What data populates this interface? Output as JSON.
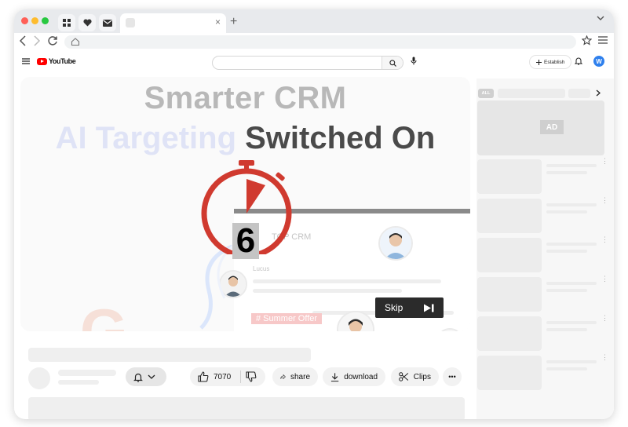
{
  "browser": {
    "traffic_lights": [
      "#ff5f57",
      "#febc2e",
      "#28c840"
    ],
    "pinned_tabs": [
      "grid-icon",
      "heart-icon",
      "mail-icon"
    ],
    "tab_close": "×",
    "new_tab": "+"
  },
  "youtube": {
    "logo_text": "YouTube",
    "create_label": "Establish",
    "avatar_letter": "W",
    "sidebar_chip_all": "ALL",
    "ad_label": "AD"
  },
  "video": {
    "headline_line1": "Smarter CRM",
    "headline_line2_part1": "AI Targeting ",
    "headline_line2_part2": "Switched On",
    "crm_label": "TOP CRM",
    "contact_name": "Lucus",
    "offer_tag": "# Summer Offer",
    "countdown": "6",
    "skip_label": "Skip"
  },
  "actions": {
    "like_count": "7070",
    "share_label": "share",
    "download_label": "download",
    "clips_label": "Clips",
    "more_label": "•••"
  },
  "colors": {
    "youtube_red": "#ff0000",
    "timer_red": "#d03a2f",
    "skip_bg": "#2b2b2b"
  }
}
